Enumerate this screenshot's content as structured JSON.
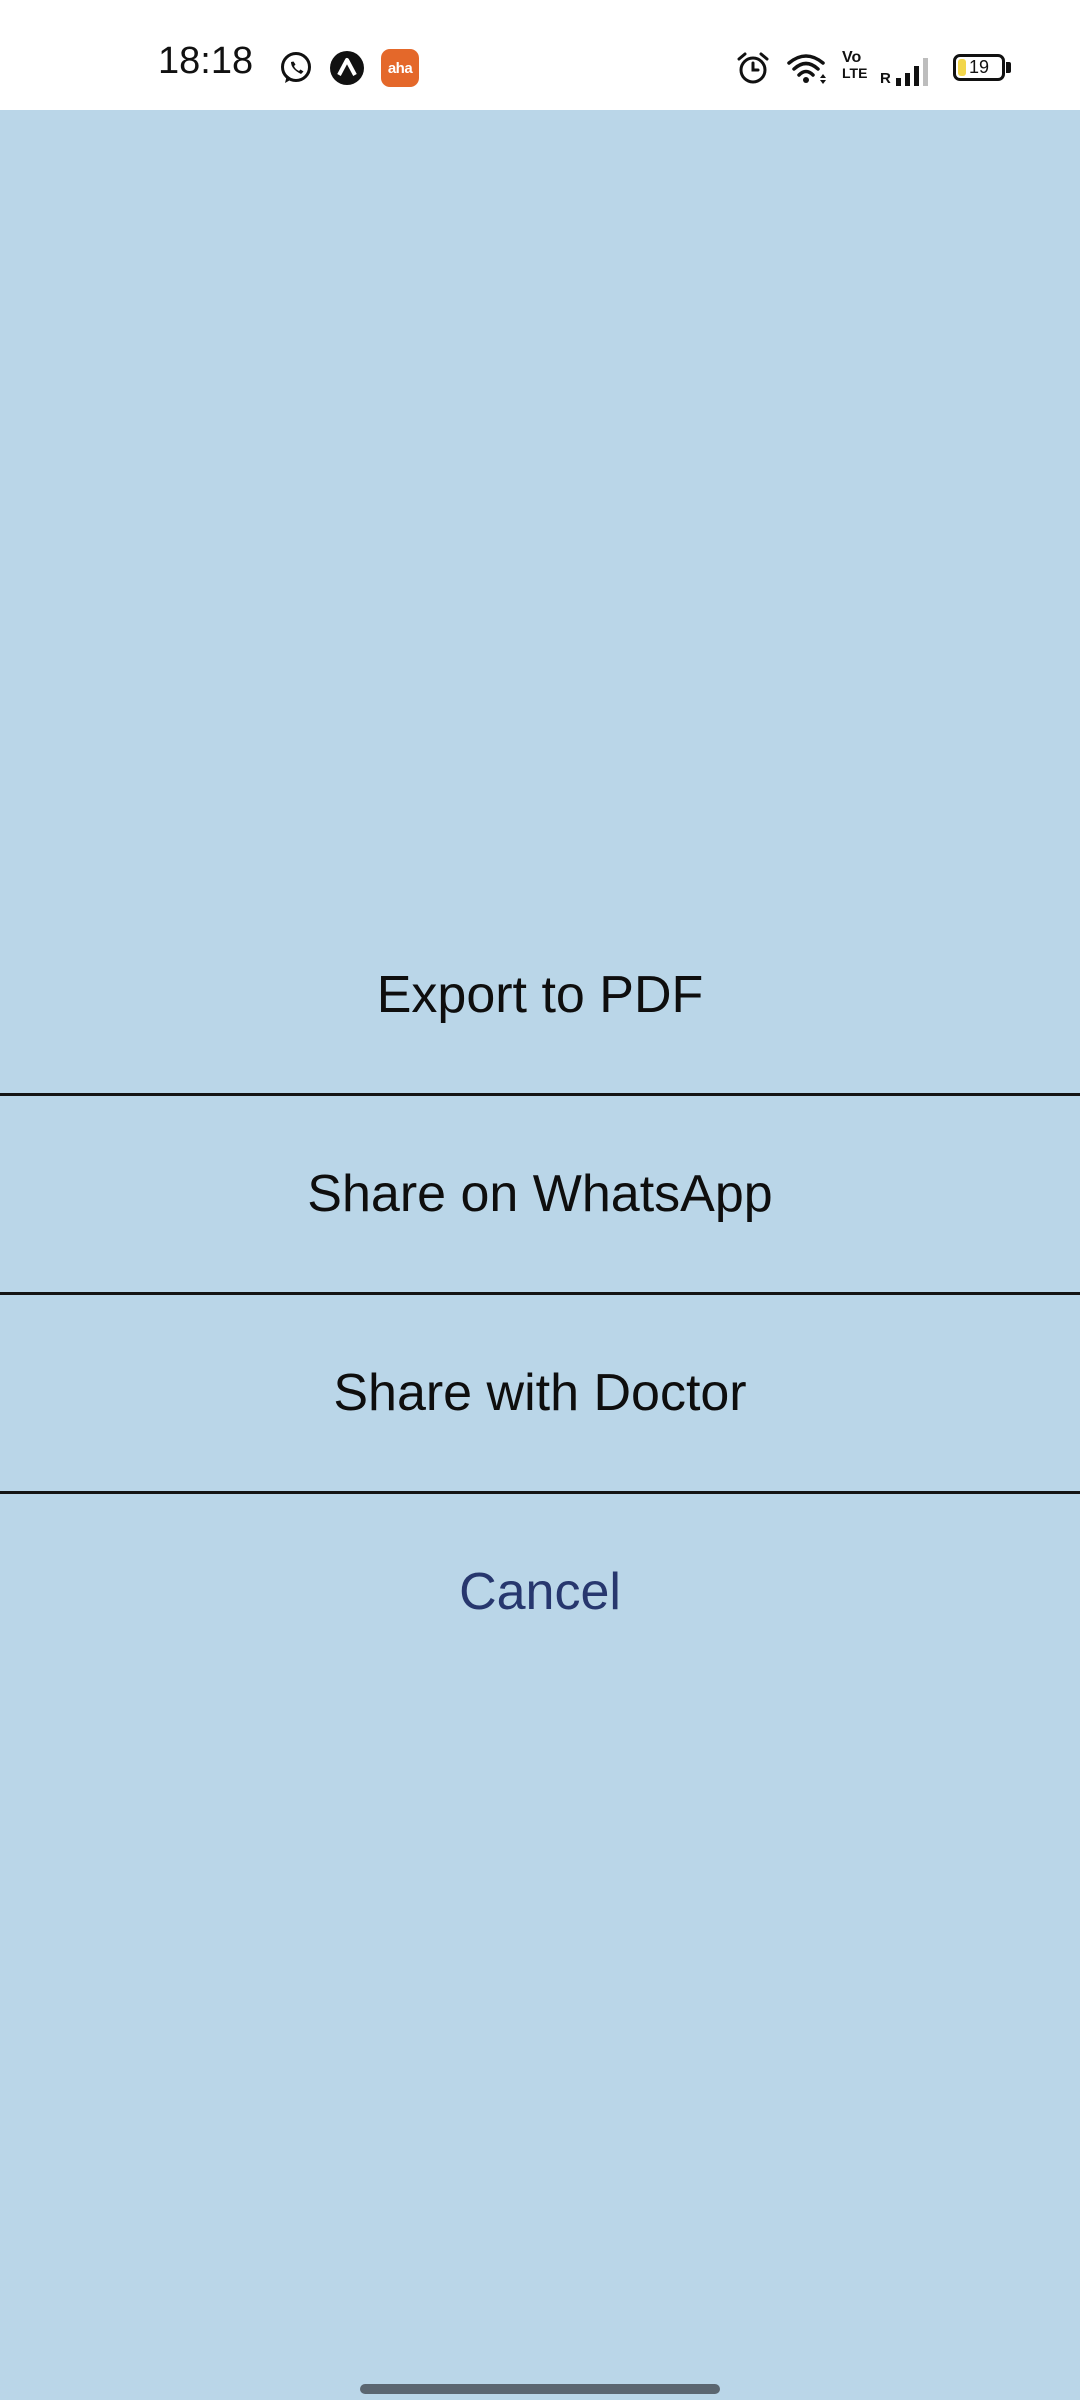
{
  "status_bar": {
    "time": "18:18",
    "notification_icons": [
      "whatsapp-icon",
      "app-triangle-icon",
      "aha-app-icon"
    ],
    "aha_label": "aha",
    "system_icons": [
      "alarm-icon",
      "wifi-icon",
      "volte-icon",
      "signal-icon",
      "battery-icon"
    ],
    "volte_label_top": "Vo",
    "volte_label_bottom": "LTE",
    "roaming_label": "R",
    "battery_level": 19,
    "battery_text": "19"
  },
  "action_sheet": {
    "items": [
      {
        "label": "Export to PDF"
      },
      {
        "label": "Share on WhatsApp"
      },
      {
        "label": "Share with Doctor"
      }
    ],
    "cancel_label": "Cancel"
  },
  "colors": {
    "background": "#bad6e8",
    "cancel_text": "#27376e",
    "divider": "#141414"
  }
}
